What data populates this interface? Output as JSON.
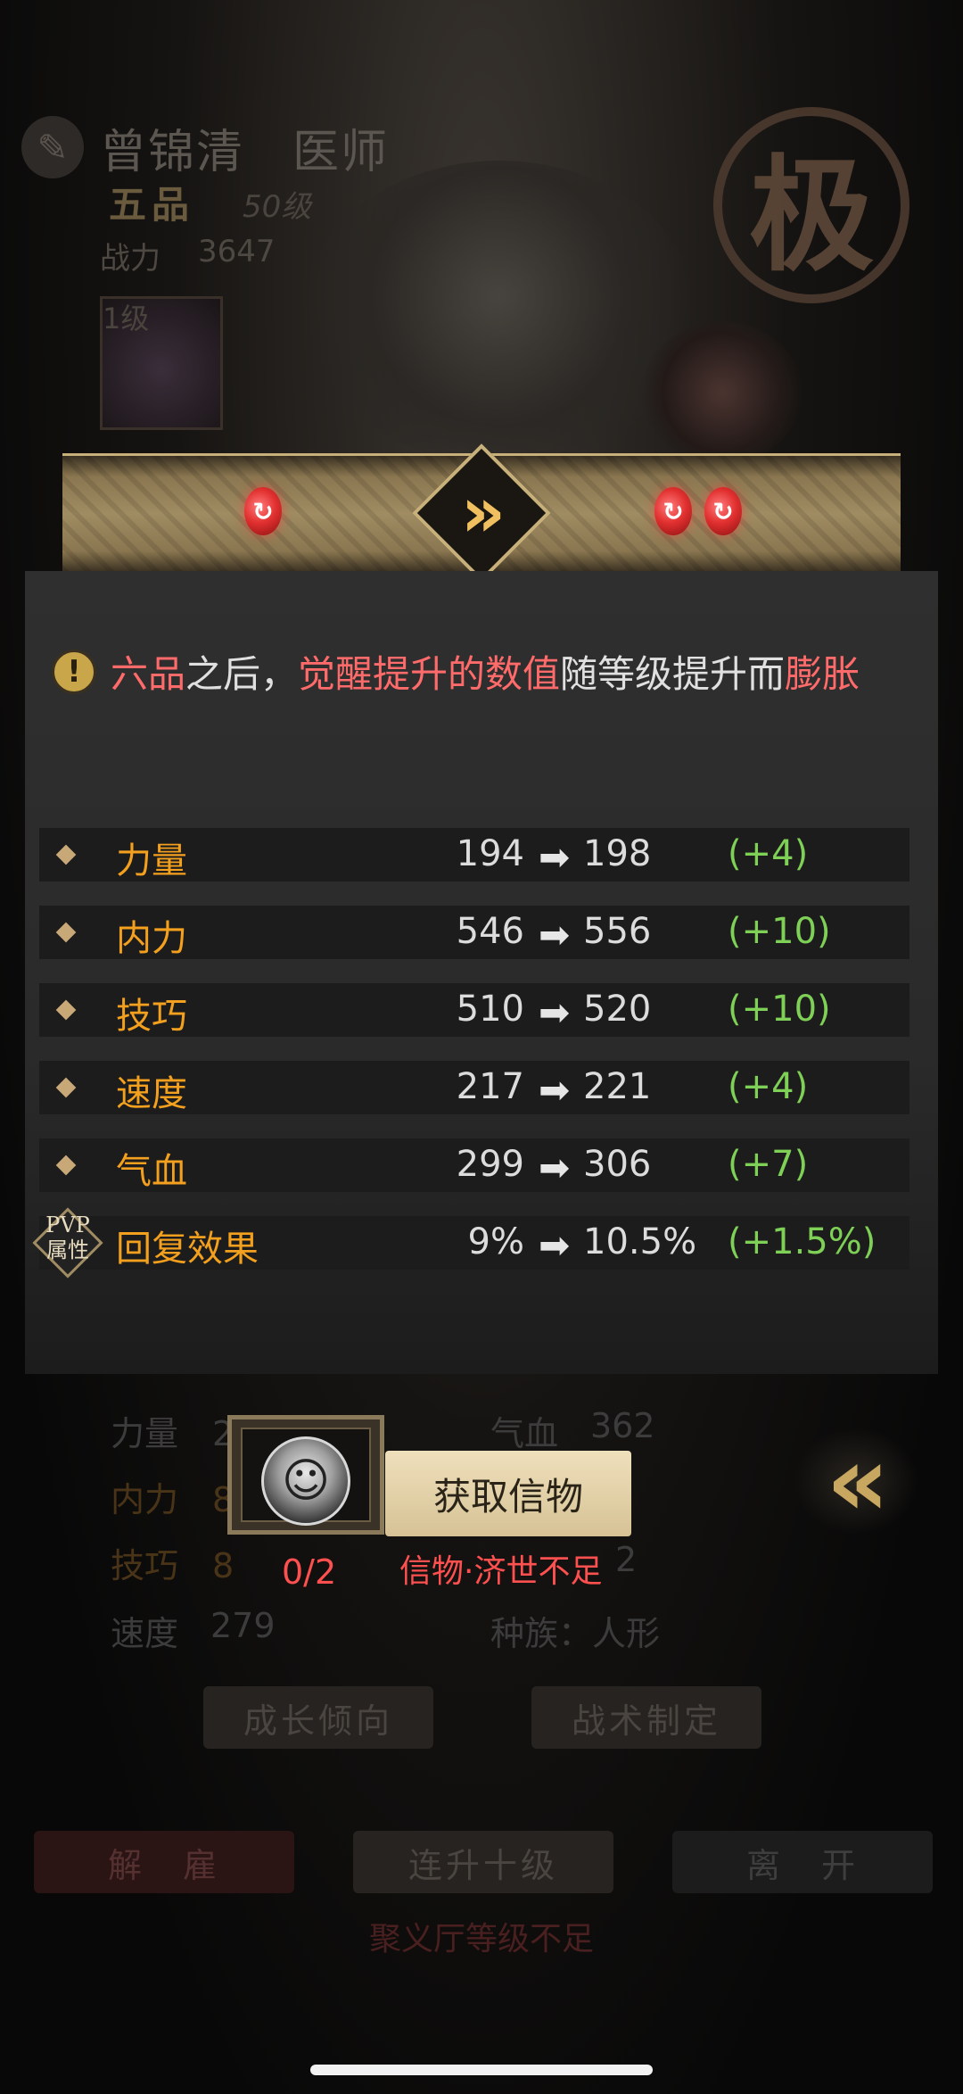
{
  "hero": {
    "name": "曾锦清",
    "profession": "医师",
    "name_line": "曾锦清　医师",
    "grade": "五品",
    "level": "50级",
    "power_label": "战力",
    "power_value": "3647",
    "item_level": "1级",
    "seal_char": "极"
  },
  "notice": {
    "part1_hl": "六品",
    "part2": "之后，",
    "part3_hl": "觉醒提升的数值",
    "part4": "随等级提升而",
    "part5_hl": "膨胀"
  },
  "stats": [
    {
      "name": "力量",
      "from": "194",
      "to": "198",
      "delta": "(+4)"
    },
    {
      "name": "内力",
      "from": "546",
      "to": "556",
      "delta": "(+10)"
    },
    {
      "name": "技巧",
      "from": "510",
      "to": "520",
      "delta": "(+10)"
    },
    {
      "name": "速度",
      "from": "217",
      "to": "221",
      "delta": "(+4)"
    },
    {
      "name": "气血",
      "from": "299",
      "to": "306",
      "delta": "(+7)"
    },
    {
      "name": "回复效果",
      "from": "9%",
      "to": "10.5%",
      "delta": "(+1.5%)",
      "badge": "PVP\n属性"
    }
  ],
  "pvp_badge": {
    "line1": "PVP",
    "line2": "属性"
  },
  "background_stats": {
    "strength": "力量　2",
    "inner": "内力　8",
    "skill": "技巧　8",
    "speed_label": "速度",
    "speed_value": "279",
    "hp_label": "气血",
    "hp_value": "362",
    "partial": "2",
    "race": "种族：人形"
  },
  "background_buttons": {
    "growth": "成长倾向",
    "tactics": "战术制定",
    "dismiss": "解　雇",
    "level_up_ten": "连升十级",
    "leave": "离　开",
    "warning": "聚义厅等级不足"
  },
  "acquire": {
    "button": "获取信物",
    "count": "0/2",
    "hint": "信物·济世不足"
  },
  "colors": {
    "accent_gold": "#c8b07a",
    "stat_name": "#f2a01e",
    "increase_green": "#7ed056",
    "warning_red": "#ff5050"
  }
}
